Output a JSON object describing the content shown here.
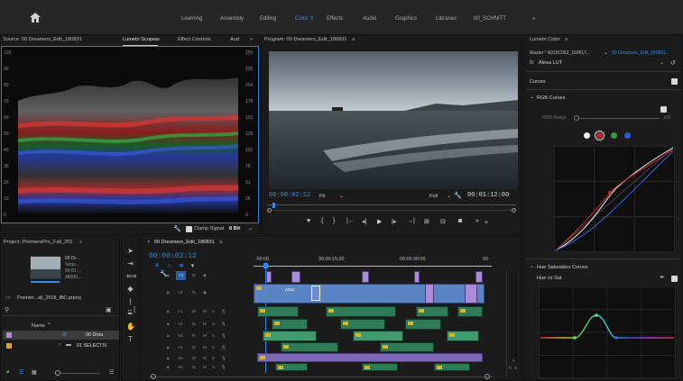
{
  "workspace_tabs": [
    "Learning",
    "Assembly",
    "Editing",
    "Color",
    "Effects",
    "Audio",
    "Graphics",
    "Libraries",
    "00_SCHNITT"
  ],
  "active_workspace": "Color",
  "overflow_glyph": "»",
  "scopes": {
    "tabs": [
      "Source: 00 Dreamers_Edit_180831",
      "Lumetri Scopes",
      "Effect Controls",
      "Aud"
    ],
    "left_ticks": [
      "100",
      "90",
      "80",
      "70",
      "60",
      "50",
      "40",
      "30",
      "20",
      "10",
      "0"
    ],
    "right_ticks": [
      "255",
      "230",
      "204",
      "178",
      "153",
      "128",
      "102",
      "76",
      "51",
      "26",
      "0"
    ],
    "clamp_label": "Clamp Signal",
    "bit_depth": "8 Bit"
  },
  "program": {
    "title": "Program: 00 Dreamers_Edit_180831",
    "timecode": "00:00:02:12",
    "fit_label": "Fit",
    "quality_label": "Full",
    "duration": "00:01:12:00"
  },
  "lumetri": {
    "title": "Lumetri Color",
    "master_clip": "Master * A010C062_160517...",
    "sequence_clip": "00 Dreamers_Edit_180831...",
    "fx_label": "fx",
    "lut_label": "Alexa LUT",
    "curves_label": "Curves",
    "rgb_curves_label": "RGB Curves",
    "hdr_range_label": "HDR Range",
    "hdr_value": "100",
    "hue_sat_label": "Hue Saturation Curves",
    "hue_vs_sat_label": "Hue vs Sat",
    "colors": {
      "white": "#f2f2f2",
      "red": "#c1272d",
      "green": "#2e9d3b",
      "blue": "#2c5bd6"
    }
  },
  "project": {
    "title": "Project: PremierePro_Fall_201",
    "clip_lines": [
      "00 Dr...",
      "Sequ...",
      "00:01:...",
      "48000..."
    ],
    "project_file": "Premier...all_2018_IBC.prproj",
    "name_header": "Name",
    "items": [
      "00 Drea",
      "01 SELECTIV"
    ]
  },
  "timeline": {
    "sequence_tab": "00 Dreamers_Edit_180831",
    "timecode": "00:00:02:12",
    "ruler": [
      ":00:00",
      "00:00:15:00",
      "00:00:30:00",
      "00"
    ],
    "tracks": [
      "V3",
      "V2",
      "V1",
      "A1",
      "A2",
      "A3",
      "A4",
      "A5",
      "A6"
    ],
    "clip_label": "A012",
    "audio_meter": [
      "0",
      "S",
      "S"
    ]
  }
}
